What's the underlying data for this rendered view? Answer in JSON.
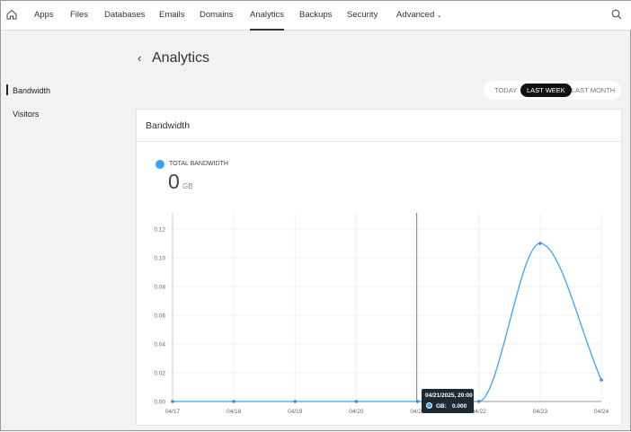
{
  "nav": {
    "items": [
      "Apps",
      "Files",
      "Databases",
      "Emails",
      "Domains",
      "Analytics",
      "Backups",
      "Security",
      "Advanced"
    ],
    "active": "Analytics"
  },
  "page": {
    "title": "Analytics"
  },
  "sidebar": {
    "items": [
      "Bandwidth",
      "Visitors"
    ]
  },
  "range": {
    "options": [
      "TODAY",
      "LAST WEEK",
      "LAST MONTH"
    ],
    "selected": "LAST WEEK"
  },
  "card": {
    "title": "Bandwidth",
    "legend": "TOTAL BANDWIDTH",
    "total": "0",
    "unit": "GB"
  },
  "tooltip": {
    "date": "04/21/2025, 20:00",
    "label": "GB:",
    "value": "0.000"
  },
  "colors": {
    "series": "#3aa3f5"
  },
  "chart_data": {
    "type": "line",
    "x": [
      "04/17",
      "04/18",
      "04/19",
      "04/20",
      "04/21",
      "04/22",
      "04/23",
      "04/24"
    ],
    "series": [
      {
        "name": "TOTAL BANDWIDTH",
        "values": [
          0,
          0,
          0,
          0,
          0,
          0,
          0.11,
          0.015
        ]
      }
    ],
    "yticks": [
      "0.00",
      "0.02",
      "0.04",
      "0.06",
      "0.08",
      "0.10",
      "0.12"
    ],
    "ylim": [
      0,
      0.12
    ],
    "grid": true
  }
}
